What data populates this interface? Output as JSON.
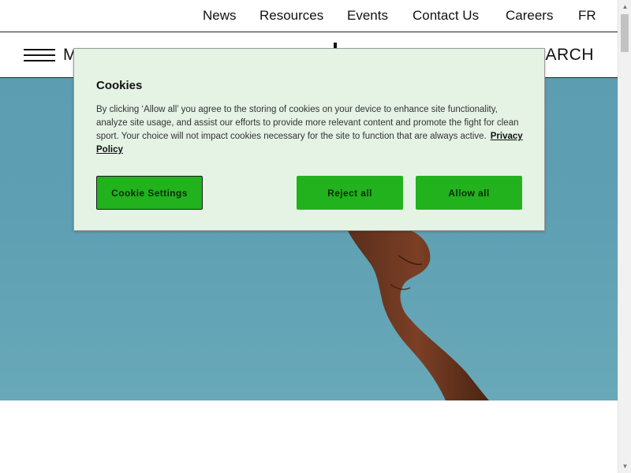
{
  "top_nav": {
    "items": [
      {
        "label": "News"
      },
      {
        "label": "Resources"
      },
      {
        "label": "Events"
      },
      {
        "label": "Contact Us"
      },
      {
        "label": "Careers"
      },
      {
        "label": "FR"
      }
    ]
  },
  "main_nav": {
    "menu_label": "MENU",
    "search_label": "SEARCH"
  },
  "cookie_banner": {
    "title": "Cookies",
    "body": "By clicking ‘Allow all’ you agree to the storing of cookies on your device to enhance site functionality, analyze site usage, and assist our efforts to provide more relevant content and promote the fight for clean sport. Your choice will not impact cookies necessary for the site to function that are always active.",
    "policy_link": "Privacy Policy",
    "buttons": {
      "settings": "Cookie Settings",
      "reject": "Reject all",
      "allow": "Allow all"
    }
  },
  "colors": {
    "accent_green": "#22b21e",
    "dialog_bg": "#e5f3e5",
    "hero_sky": "#5e9fb3"
  },
  "icons": {
    "menu": "hamburger-icon",
    "scroll_up": "triangle-up-icon",
    "scroll_down": "triangle-down-icon"
  }
}
